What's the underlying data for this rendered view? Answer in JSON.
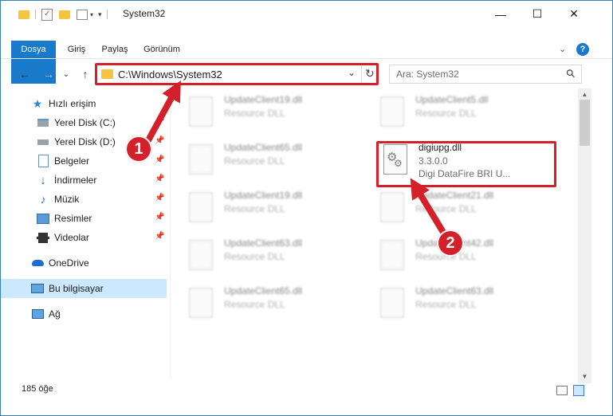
{
  "window": {
    "title": "System32",
    "minimize": "—",
    "maximize": "☐",
    "close": "✕"
  },
  "ribbon": {
    "tabs": [
      "Dosya",
      "Giriş",
      "Paylaş",
      "Görünüm"
    ],
    "collapse": "⌄",
    "help": "?"
  },
  "nav": {
    "back": "←",
    "forward": "→",
    "recent": "⌄",
    "up": "↑",
    "address": "C:\\Windows\\System32",
    "address_dropdown": "⌄",
    "refresh": "↻",
    "search_placeholder": "Ara: System32",
    "search_icon": "⚲"
  },
  "sidebar": {
    "items": [
      {
        "label": "Hızlı erişim",
        "icon": "star-icon"
      },
      {
        "label": "Yerel Disk (C:)",
        "icon": "drive-icon"
      },
      {
        "label": "Yerel Disk (D:)",
        "icon": "drive-icon"
      },
      {
        "label": "Belgeler",
        "icon": "documents-icon"
      },
      {
        "label": "İndirmeler",
        "icon": "download-icon"
      },
      {
        "label": "Müzik",
        "icon": "music-icon"
      },
      {
        "label": "Resimler",
        "icon": "pictures-icon"
      },
      {
        "label": "Videolar",
        "icon": "videos-icon"
      },
      {
        "label": "OneDrive",
        "icon": "cloud-icon"
      },
      {
        "label": "Bu bilgisayar",
        "icon": "computer-icon"
      },
      {
        "label": "Ağ",
        "icon": "network-icon"
      }
    ]
  },
  "files": {
    "left": [
      {
        "name": "UpdateClient19.dll",
        "type": "Resource DLL"
      },
      {
        "name": "UpdateClient65.dll",
        "type": "Resource DLL"
      },
      {
        "name": "UpdateClient19.dll",
        "type": "Resource DLL"
      },
      {
        "name": "UpdateClient63.dll",
        "type": "Resource DLL"
      },
      {
        "name": "UpdateClient65.dll",
        "type": "Resource DLL"
      }
    ],
    "right": [
      {
        "name": "UpdateClient5.dll",
        "type": "Resource DLL"
      },
      {
        "name": "UpdateClient21.dll",
        "type": "Resource DLL"
      },
      {
        "name": "UpdateClient42.dll",
        "type": "Resource DLL"
      },
      {
        "name": "UpdateClient63.dll",
        "type": "Resource DLL"
      }
    ],
    "highlighted": {
      "name": "digiupg.dll",
      "version": "3.3.0.0",
      "description": "Digi DataFire BRI U..."
    }
  },
  "status": {
    "item_count": "185 öğe"
  },
  "annotations": {
    "step1": "1",
    "step2": "2",
    "color": "#d3202a"
  }
}
